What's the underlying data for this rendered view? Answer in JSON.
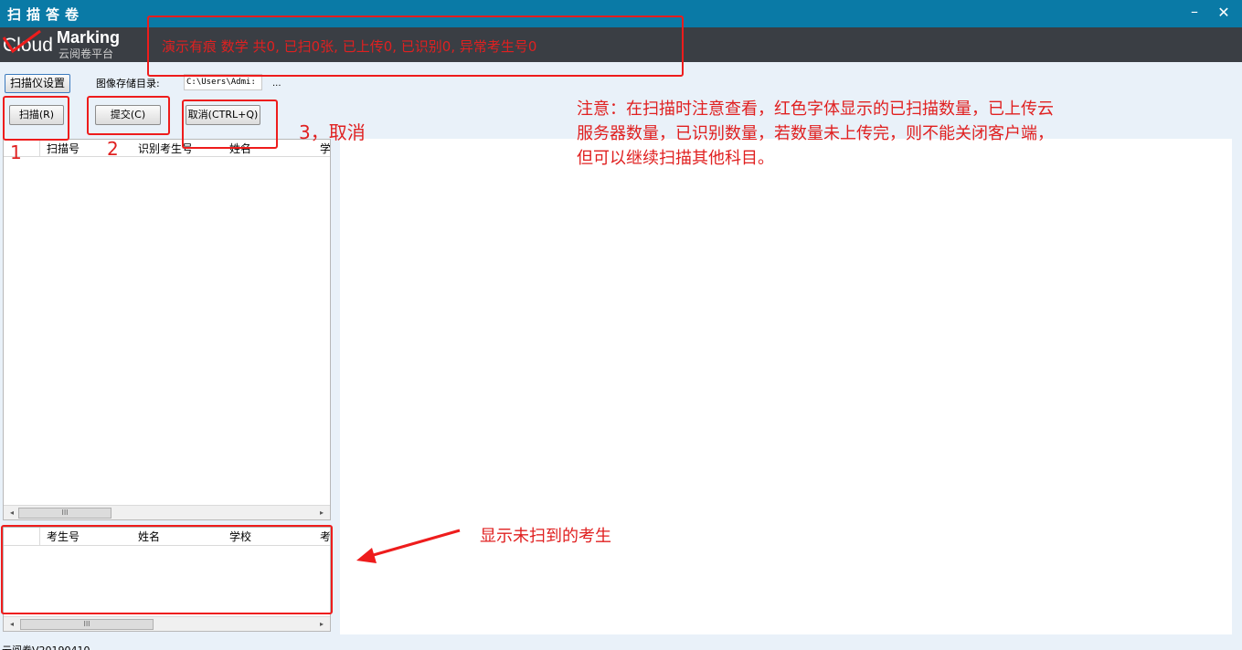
{
  "window": {
    "title": "扫描答卷",
    "minimize_icon": "minimize-icon",
    "close_icon": "close-icon"
  },
  "header": {
    "logo_cloud": "Cloud",
    "logo_marking": "Marking",
    "logo_subtitle": "云阅卷平台",
    "status": "演示有痕  数学  共0, 已扫0张, 已上传0, 已识别0, 异常考生号0"
  },
  "toolbar": {
    "scanner_settings_label": "扫描仪设置",
    "image_dir_label": "图像存储目录:",
    "image_dir_value": "C:\\Users\\Admi:",
    "browse_label": "...",
    "scan_label": "扫描(R)",
    "submit_label": "提交(C)",
    "cancel_label": "取消(CTRL+Q)"
  },
  "scanned_grid": {
    "columns": [
      "扫描号",
      "识别考生号",
      "姓名",
      "学"
    ]
  },
  "unscanned_grid": {
    "columns": [
      "考生号",
      "姓名",
      "学校",
      "考"
    ]
  },
  "scrollbar": {
    "left_arrow": "◂",
    "right_arrow": "▸",
    "thumb_grip": "III"
  },
  "footer": {
    "version": "云阅卷V20190410"
  },
  "annotations": {
    "num1": "1",
    "num2": "2",
    "num3": "3，取消",
    "note_lines": [
      "注意：在扫描时注意查看，红色字体显示的已扫描数量，已上传云",
      "服务器数量，已识别数量，若数量未上传完，则不能关闭客户端，",
      "但可以继续扫描其他科目。"
    ],
    "unscanned_note": "显示未扫到的考生",
    "color": "#e02020"
  }
}
